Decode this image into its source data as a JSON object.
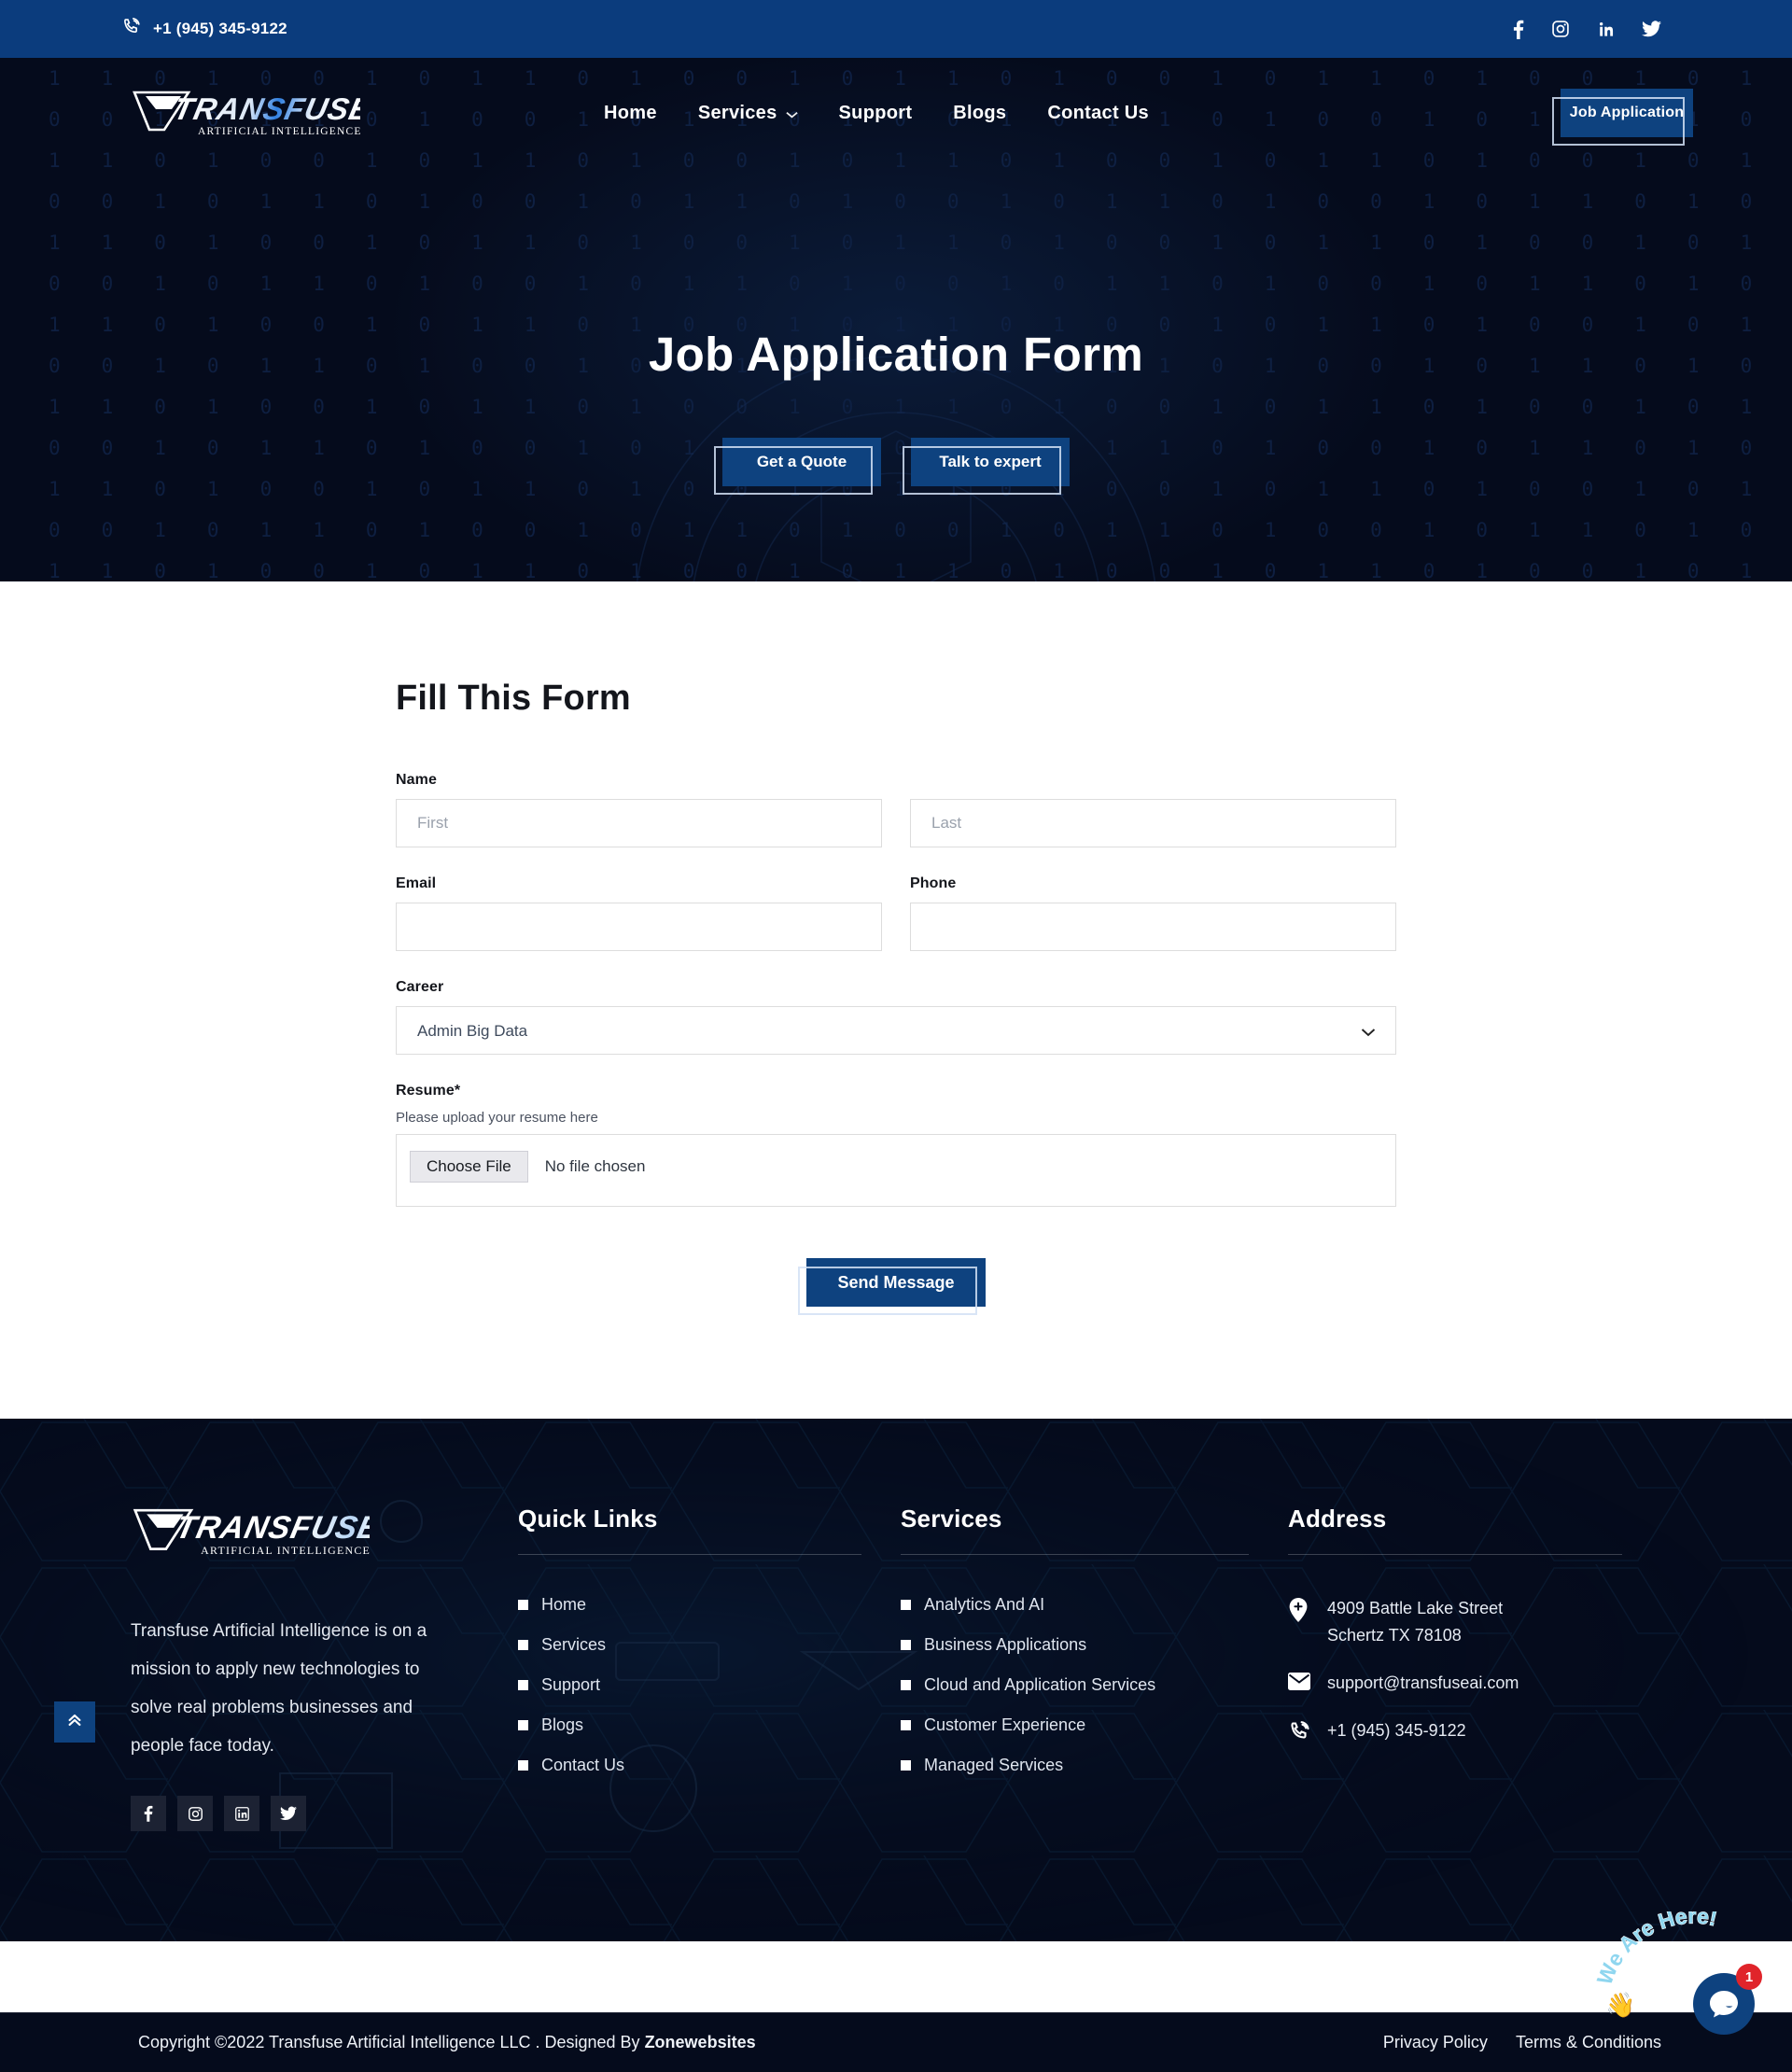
{
  "topbar": {
    "phone": "+1 (945) 345-9122",
    "phone_icon": "phone-ring-icon",
    "socials": [
      {
        "name": "facebook-icon",
        "label": "Facebook"
      },
      {
        "name": "instagram-icon",
        "label": "Instagram"
      },
      {
        "name": "linkedin-icon",
        "label": "LinkedIn"
      },
      {
        "name": "twitter-icon",
        "label": "Twitter"
      }
    ]
  },
  "brand": {
    "name": "TRANSFUSE",
    "tagline": "ARTIFICIAL INTELLIGENCE"
  },
  "nav": {
    "links": [
      {
        "label": "Home",
        "has_dropdown": false
      },
      {
        "label": "Services",
        "has_dropdown": true
      },
      {
        "label": "Support",
        "has_dropdown": false
      },
      {
        "label": "Blogs",
        "has_dropdown": false
      },
      {
        "label": "Contact Us",
        "has_dropdown": false
      }
    ],
    "cta_label": "Job Application"
  },
  "hero": {
    "title": "Job Application Form",
    "buttons": [
      {
        "label": "Get a Quote"
      },
      {
        "label": "Talk to expert"
      }
    ]
  },
  "form": {
    "title": "Fill This Form",
    "name_label": "Name",
    "first_placeholder": "First",
    "last_placeholder": "Last",
    "first_value": "",
    "last_value": "",
    "email_label": "Email",
    "email_value": "",
    "phone_label": "Phone",
    "phone_value": "",
    "career_label": "Career",
    "career_selected": "Admin Big Data",
    "career_options": [
      "Admin Big Data"
    ],
    "resume_label": "Resume*",
    "resume_hint": "Please upload your resume here",
    "choose_file_label": "Choose File",
    "no_file_label": "No file chosen",
    "submit_label": "Send Message"
  },
  "footer": {
    "description": "Transfuse Artificial Intelligence is on a mission to apply new technologies to solve real problems businesses and people face today.",
    "socials": [
      {
        "name": "facebook-icon",
        "label": "Facebook"
      },
      {
        "name": "instagram-icon",
        "label": "Instagram"
      },
      {
        "name": "linkedin-icon",
        "label": "LinkedIn"
      },
      {
        "name": "twitter-icon",
        "label": "Twitter"
      }
    ],
    "quick_links": {
      "heading": "Quick Links",
      "items": [
        {
          "label": "Home"
        },
        {
          "label": "Services"
        },
        {
          "label": "Support"
        },
        {
          "label": "Blogs"
        },
        {
          "label": "Contact Us"
        }
      ]
    },
    "services": {
      "heading": "Services",
      "items": [
        {
          "label": "Analytics And AI"
        },
        {
          "label": "Business Applications"
        },
        {
          "label": "Cloud and Application Services"
        },
        {
          "label": "Customer Experience"
        },
        {
          "label": "Managed Services"
        }
      ]
    },
    "address": {
      "heading": "Address",
      "street_line1": "4909 Battle Lake Street",
      "street_line2": "Schertz TX 78108",
      "email": "support@transfuseai.com",
      "phone": "+1 (945) 345-9122"
    }
  },
  "bottombar": {
    "copyright_prefix": "Copyright ©2022 Transfuse Artificial Intelligence LLC . Designed By ",
    "designer": "Zonewebsites",
    "privacy_label": "Privacy Policy",
    "terms_label": "Terms & Conditions"
  },
  "widgets": {
    "scroll_top_icon": "double-chevron-up-icon",
    "chat_label": "We Are Here!",
    "chat_badge_count": "1",
    "wave_emoji": "👋"
  },
  "colors": {
    "brand_blue": "#0b3c7d",
    "button_blue": "#0e427f",
    "dark_navy": "#050b1c",
    "badge_red": "#e0242a",
    "chat_text_blue": "#8fd6ef"
  }
}
